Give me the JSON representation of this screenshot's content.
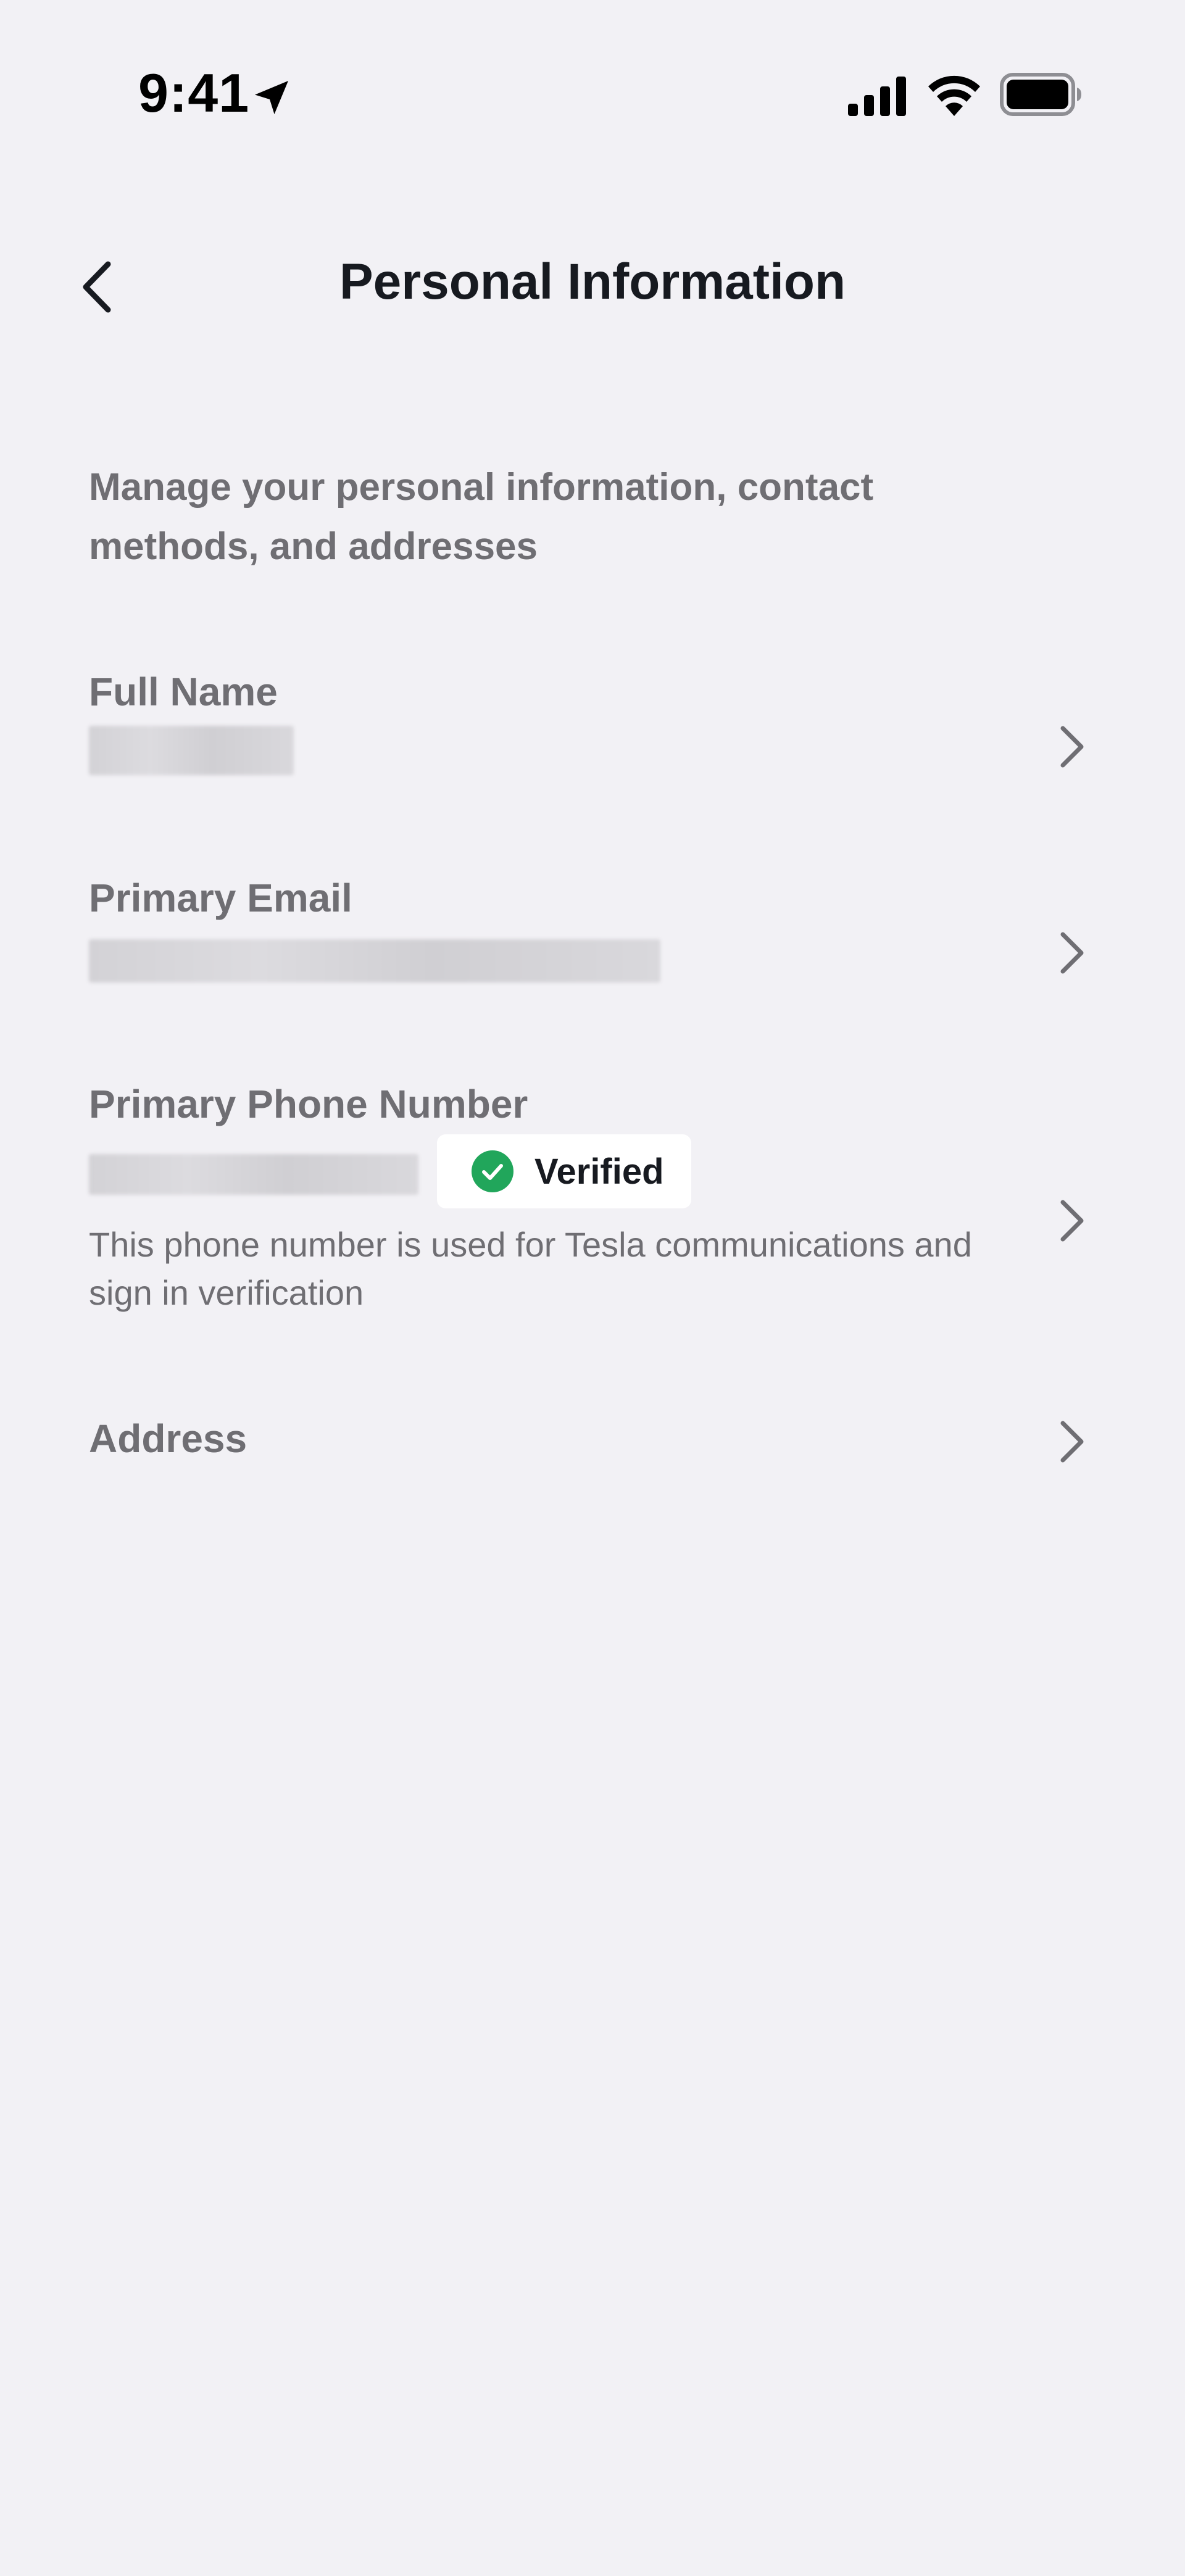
{
  "status_bar": {
    "time": "9:41",
    "icons": [
      "location-arrow-icon",
      "cellular-signal-icon",
      "wifi-icon",
      "battery-icon"
    ]
  },
  "header": {
    "title": "Personal Information",
    "back_icon": "chevron-left-icon"
  },
  "description": "Manage your personal information, contact methods, and addresses",
  "rows": [
    {
      "label": "Full Name",
      "value_redacted": true
    },
    {
      "label": "Primary Email",
      "value_redacted": true
    },
    {
      "label": "Primary Phone Number",
      "value_redacted": true,
      "badge": {
        "label": "Verified",
        "icon": "check-circle-icon",
        "color": "#21a65b"
      },
      "note": "This phone number is used for Tesla communications and sign in verification"
    },
    {
      "label": "Address"
    }
  ],
  "colors": {
    "background": "#f2f1f5",
    "title": "#171a20",
    "label": "#6f6e73",
    "verified": "#21a65b"
  }
}
